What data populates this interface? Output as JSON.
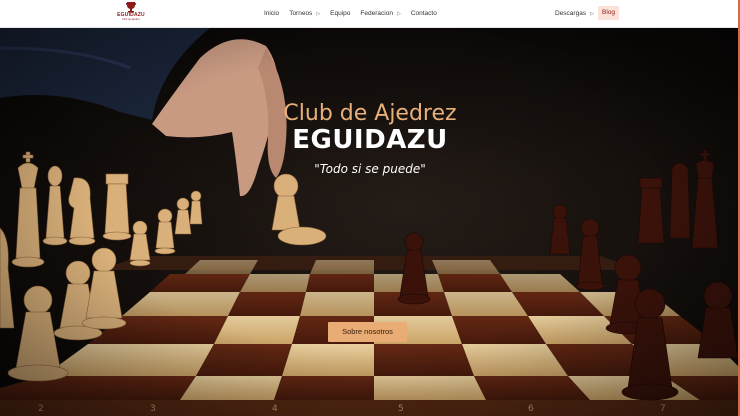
{
  "header": {
    "logo": {
      "text": "EGUIDAZU",
      "subtext": "Club de Ajedrez"
    },
    "nav": [
      {
        "label": "Inicio",
        "has_submenu": false
      },
      {
        "label": "Torneos",
        "has_submenu": true
      },
      {
        "label": "Equipo",
        "has_submenu": false
      },
      {
        "label": "Federacion",
        "has_submenu": true
      },
      {
        "label": "Contacto",
        "has_submenu": false
      }
    ],
    "downloads": {
      "label": "Descargas",
      "has_submenu": true
    },
    "blog": {
      "label": "Blog"
    }
  },
  "hero": {
    "title": "Club de Ajedrez",
    "brand": "EGUIDAZU",
    "motto": "\"Todo si se puede\"",
    "cta_label": "Sobre nosotros"
  },
  "board": {
    "file_labels": [
      "2",
      "3",
      "4",
      "5",
      "6",
      "7"
    ]
  },
  "colors": {
    "accent": "#e8ac74",
    "title": "#e8b078",
    "blog_bg": "#fbe3d9",
    "brand_red": "#8b1a1a"
  },
  "icons": [
    "trophy-logo-icon",
    "chevron-right-icon"
  ]
}
